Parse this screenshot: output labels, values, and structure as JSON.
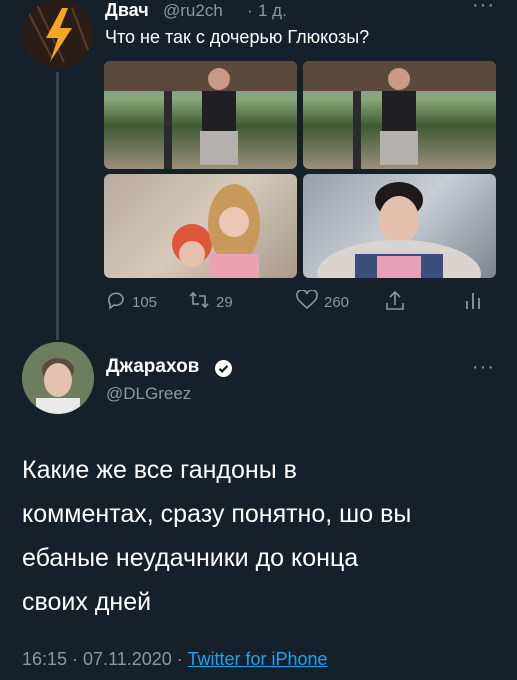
{
  "parent_tweet": {
    "author_name": "Двач",
    "author_handle": "@ru2ch",
    "separator": "·",
    "time": "1 д.",
    "text": "Что не так с дочерью Глюкозы?",
    "more_icon": "more-icon",
    "actions": {
      "reply_count": "105",
      "retweet_count": "29",
      "like_count": "260"
    }
  },
  "main_tweet": {
    "author_name": "Джарахов",
    "author_handle": "@DLGreez",
    "text_lines": [
      "Какие же все гандоны в",
      "комментах, сразу понятно, шо вы",
      "ебаные неудачники до конца",
      "своих дней"
    ],
    "timestamp": "16:15 · 07.11.2020 · ",
    "source": "Twitter for iPhone"
  },
  "colors": {
    "background": "#15202b",
    "muted": "#8899a6",
    "link": "#1da1f2",
    "divider": "#38444d"
  }
}
